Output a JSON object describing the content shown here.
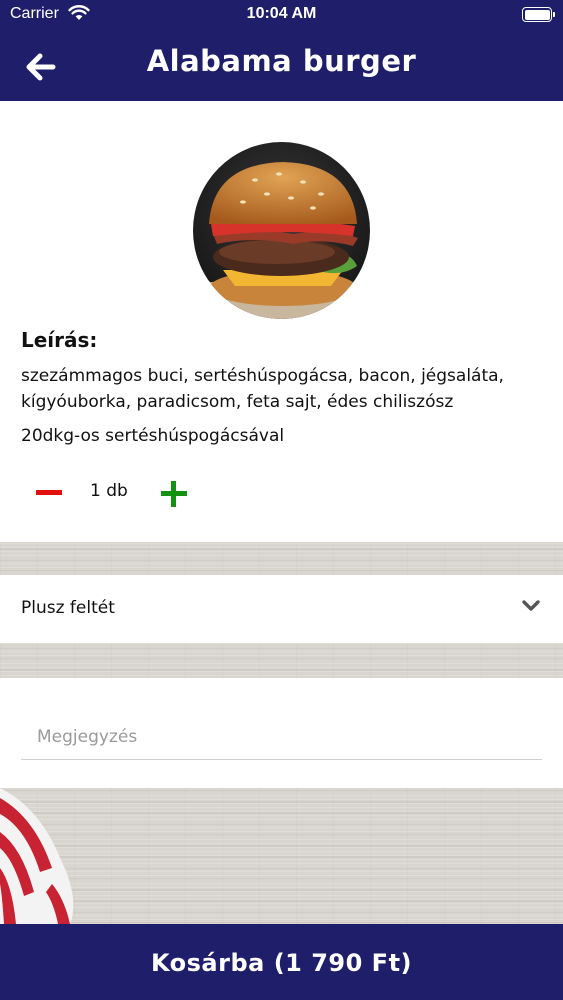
{
  "status_bar": {
    "carrier": "Carrier",
    "time": "10:04 AM",
    "icons": [
      "wifi-icon",
      "battery-icon"
    ]
  },
  "nav": {
    "back_icon": "arrow-left-icon",
    "title": "Alabama burger"
  },
  "product": {
    "image": "burger-photo",
    "description_heading": "Leírás:",
    "description": "szezámmagos buci, sertéshúspogácsa, bacon, jégsaláta, kígyóuborka, paradicsom, feta sajt, édes chiliszósz",
    "weight_note": "20dkg-os sertéshúspogácsával",
    "quantity": "1 db"
  },
  "extras": {
    "label": "Plusz feltét",
    "icon": "chevron-down-icon"
  },
  "note": {
    "placeholder": "Megjegyzés",
    "value": ""
  },
  "cart": {
    "button_label": "Kosárba (1 790 Ft)"
  },
  "colors": {
    "primary": "#1e1e6a",
    "minus": "#e30e0e",
    "plus": "#129112"
  }
}
